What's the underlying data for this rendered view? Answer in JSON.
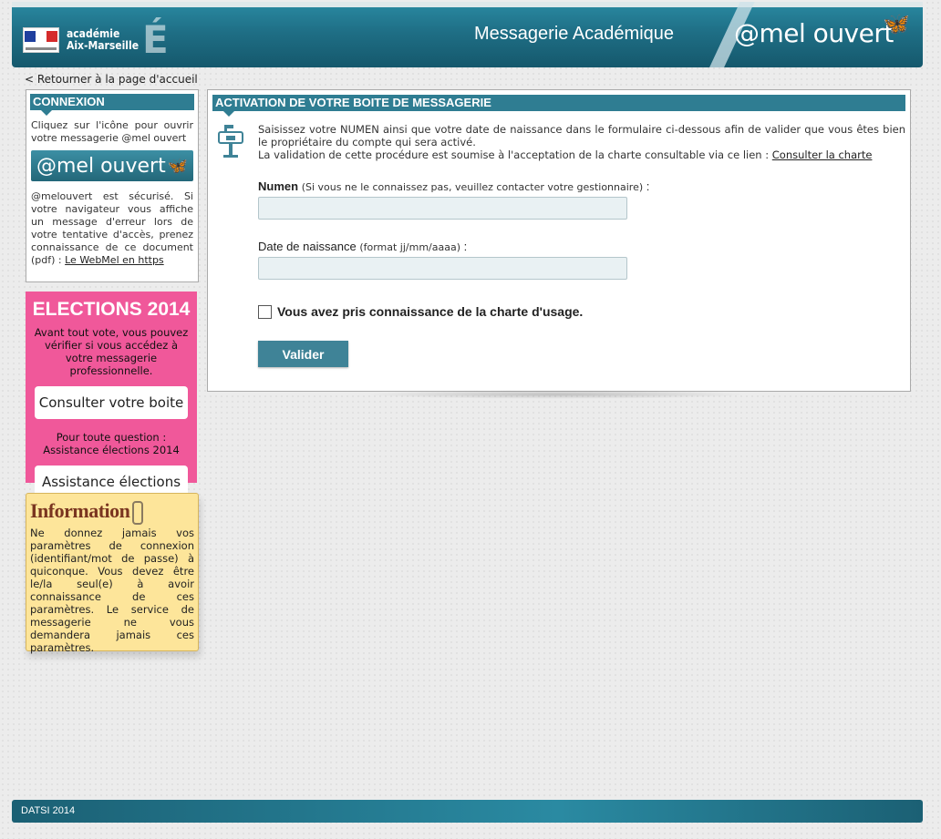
{
  "header": {
    "academy_line1": "académie",
    "academy_line2": "Aix-Marseille",
    "academy_emblem": "É",
    "title": "Messagerie Académique",
    "brand": "@mel ouvert",
    "brand_icon": "butterfly-icon"
  },
  "nav": {
    "back_link": "< Retourner à la page d'accueil"
  },
  "connexion": {
    "title": "CONNEXION",
    "intro": "Cliquez sur l'icône pour ouvrir votre messagerie @mel ouvert",
    "button_label": "@mel ouvert",
    "security_text": "@melouvert est sécurisé. Si votre navigateur vous affiche un message d'erreur lors de votre tentative d'accès, prenez connaissance de ce document (pdf) :",
    "security_link": "Le WebMel en https"
  },
  "elections": {
    "title": "ELECTIONS 2014",
    "intro": "Avant tout vote, vous pouvez vérifier si vous accédez à votre messagerie professionnelle.",
    "consult_button": "Consulter votre boite",
    "question_line1": "Pour toute question :",
    "question_line2": "Assistance élections 2014",
    "assist_button": "Assistance élections",
    "color": "#f0589a"
  },
  "information": {
    "title": "Information",
    "text": "Ne donnez jamais vos paramètres de connexion (identifiant/mot de passe) à quiconque. Vous devez être le/la seul(e) à avoir connaissance de ces paramètres. Le service de messagerie ne vous demandera jamais ces paramètres."
  },
  "activation": {
    "title": "ACTIVATION DE VOTRE BOITE DE MESSAGERIE",
    "intro_line1": "Saisissez votre NUMEN ainsi que votre date de naissance dans le formulaire ci-dessous afin de valider que vous êtes bien le propriétaire du compte qui sera activé.",
    "intro_line2": "La validation de cette procédure est soumise à l'acceptation de la charte consultable via ce lien :",
    "charter_link": "Consulter la charte",
    "numen_label": "Numen",
    "numen_hint": "(Si vous ne le connaissez pas, veuillez contacter votre gestionnaire)",
    "numen_value": "",
    "dob_label": "Date de naissance",
    "dob_hint": "(format jj/mm/aaaa)",
    "dob_value": "",
    "checkbox_label": "Vous avez pris connaissance de la charte d'usage.",
    "checkbox_checked": false,
    "submit_label": "Valider",
    "accent_color": "#2f7d92"
  },
  "footer": {
    "text": "DATSI 2014"
  }
}
